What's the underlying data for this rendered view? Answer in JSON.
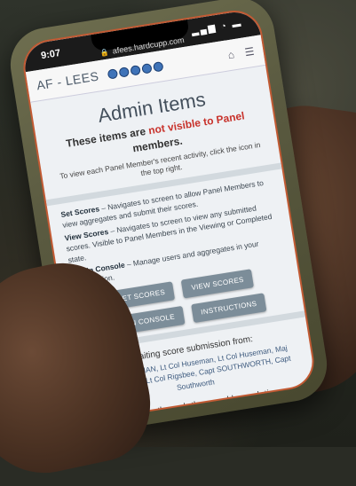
{
  "status_bar": {
    "time": "9:07",
    "url": "afees.hardcupp.com",
    "icons": "▂▄▆ ◔ ▬"
  },
  "app_bar": {
    "title": "AF - LEES",
    "home_icon": "⌂",
    "menu_icon": "☰"
  },
  "page": {
    "title": "Admin Items",
    "subtitle_prefix": "These items are",
    "subtitle_red": "not visible to Panel",
    "subtitle_suffix": "members.",
    "hint": "To view each Panel Member's recent activity, click the icon in the top right.",
    "items": [
      {
        "name": "Set Scores",
        "text": "– Navigates to screen to allow Panel Members to view aggregates and submit their scores."
      },
      {
        "name": "View Scores",
        "text": "– Navigates to screen to view any submitted scores. Visible to Panel Members in the Viewing or Completed state."
      },
      {
        "name": "Admin Console",
        "text": "– Manage users and aggregates in your organization."
      }
    ],
    "buttons": {
      "set_scores": "SET SCORES",
      "view_scores": "VIEW SCORES",
      "admin_console": "ADMIN CONSOLE",
      "instructions": "INSTRUCTIONS"
    },
    "awaiting_title": "Awaiting score submission from:",
    "awaiting_names": "Lt Col HUSEMAN, Lt Col Huseman, Lt Col Huseman, Maj Linares Ayala, Lt Col Rigsbee, Capt SOUTHWORTH, Capt Southworth",
    "progress_text": "Progress through the panel by updating"
  }
}
